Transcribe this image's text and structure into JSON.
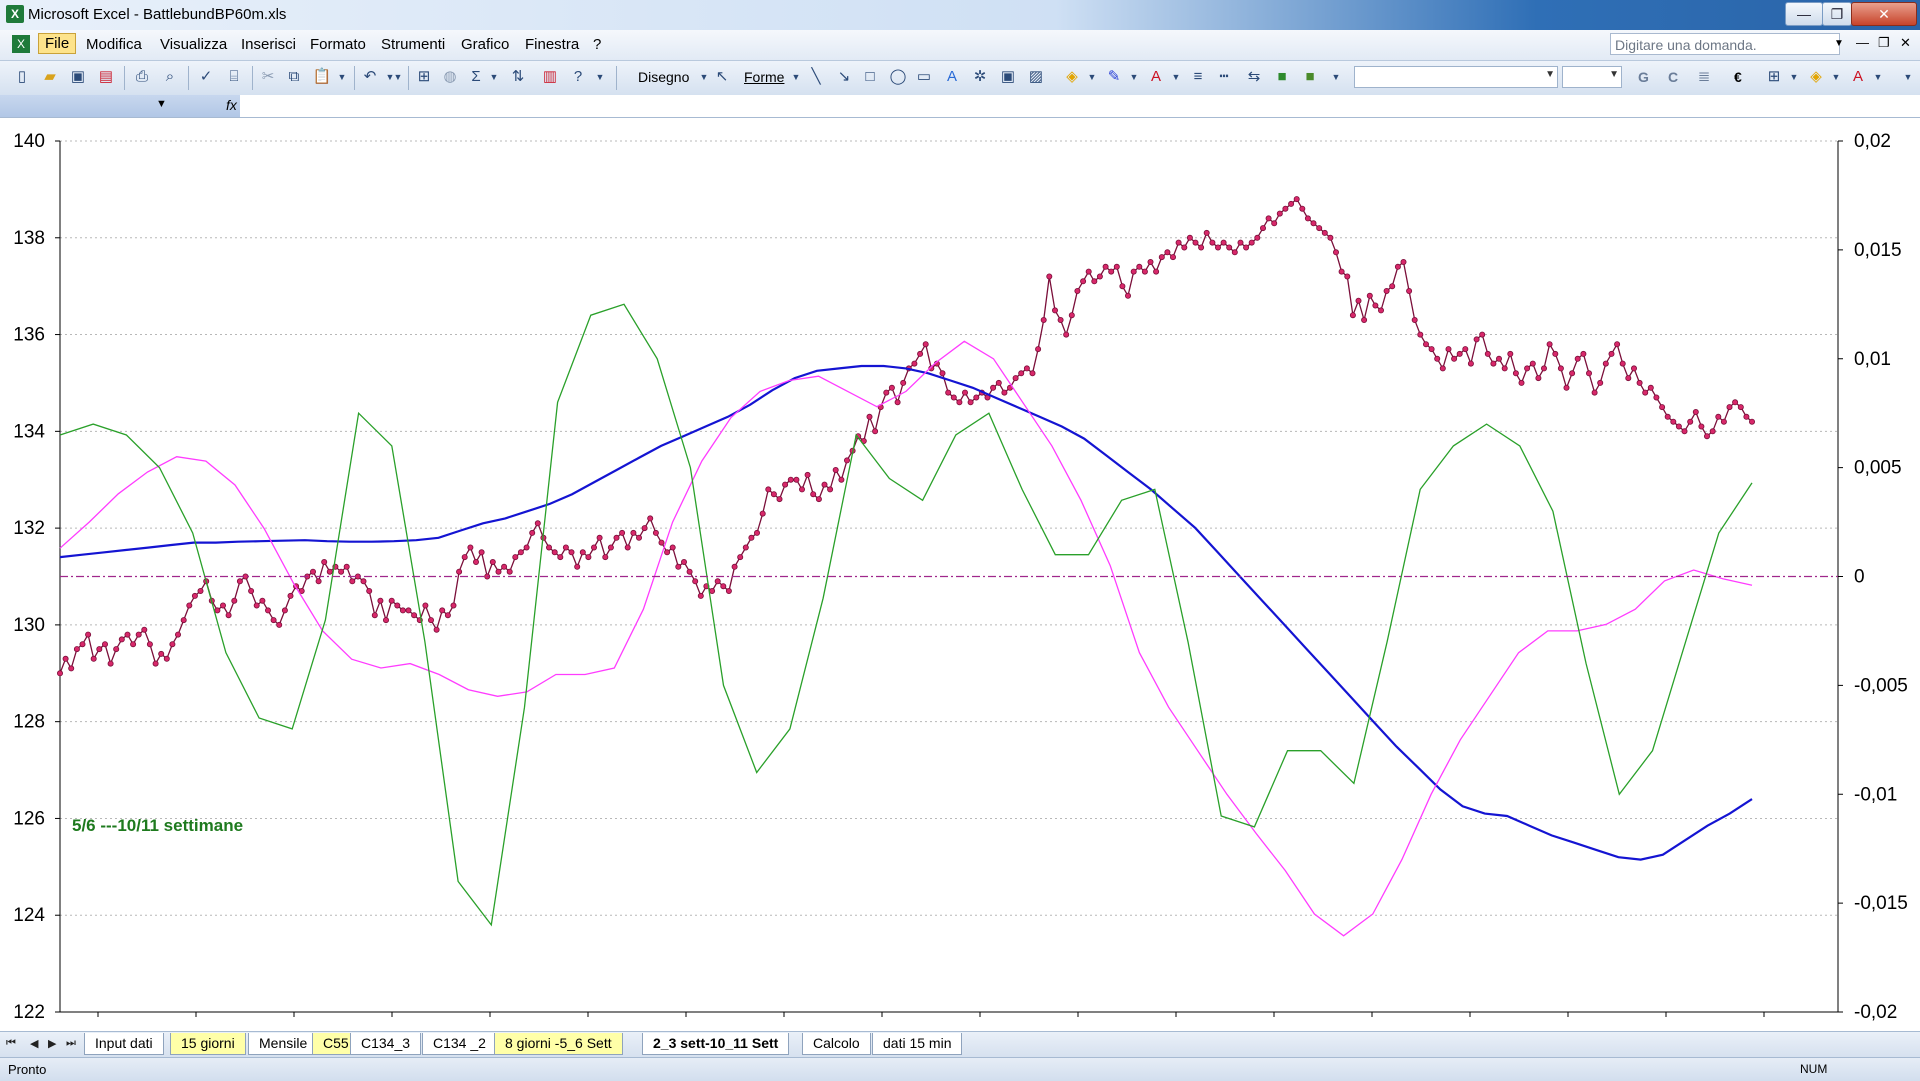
{
  "window": {
    "app_title": "Microsoft Excel - BattlebundBP60m.xls",
    "controls": [
      "—",
      "❐",
      "✕"
    ]
  },
  "menu": {
    "items": [
      "File",
      "Modifica",
      "Visualizza",
      "Inserisci",
      "Formato",
      "Strumenti",
      "Grafico",
      "Finestra",
      "?"
    ],
    "help_placeholder": "Digitare una domanda.",
    "doc_controls": [
      "—",
      "❐",
      "✕"
    ]
  },
  "toolbar": {
    "drawing_label": "Disegno",
    "shapes_label": "Forme",
    "bold_label": "G",
    "italic_label": "C",
    "euro_label": "€"
  },
  "formula_bar": {
    "fx_label": "fx"
  },
  "chart": {
    "annotation": "5/6 ---10/11 settimane",
    "annotation_color": "#1e7a1e",
    "y_left_ticks": [
      "140",
      "138",
      "136",
      "134",
      "132",
      "130",
      "128",
      "126",
      "124",
      "122"
    ],
    "y_right_ticks": [
      "0,02",
      "0,015",
      "0,01",
      "0,005",
      "0",
      "-0,005",
      "-0,01",
      "-0,015",
      "-0,02"
    ]
  },
  "chart_data": {
    "type": "line",
    "title": "",
    "xlabel": "",
    "ylabel": "",
    "ylim_left": [
      122,
      140
    ],
    "ylim_right": [
      -0.02,
      0.02
    ],
    "grid": "horizontal dotted",
    "x_points": 226,
    "series": [
      {
        "axis": "left",
        "color": "#7b0f3a",
        "marker_color": "#d8286a",
        "markers": true,
        "values": [
          129.0,
          129.3,
          129.1,
          129.5,
          129.6,
          129.8,
          129.3,
          129.5,
          129.6,
          129.2,
          129.5,
          129.7,
          129.8,
          129.6,
          129.8,
          129.9,
          129.6,
          129.2,
          129.4,
          129.3,
          129.6,
          129.8,
          130.1,
          130.4,
          130.6,
          130.7,
          130.9,
          130.5,
          130.3,
          130.4,
          130.2,
          130.5,
          130.9,
          131.0,
          130.7,
          130.4,
          130.5,
          130.3,
          130.1,
          130.0,
          130.3,
          130.6,
          130.8,
          130.7,
          131.0,
          131.1,
          130.9,
          131.3,
          131.1,
          131.2,
          131.1,
          131.2,
          130.9,
          131.0,
          130.9,
          130.7,
          130.2,
          130.5,
          130.1,
          130.5,
          130.4,
          130.3,
          130.3,
          130.2,
          130.1,
          130.4,
          130.1,
          129.9,
          130.3,
          130.2,
          130.4,
          131.1,
          131.4,
          131.6,
          131.3,
          131.5,
          131.0,
          131.3,
          131.1,
          131.2,
          131.1,
          131.4,
          131.5,
          131.6,
          131.9,
          132.1,
          131.8,
          131.6,
          131.5,
          131.4,
          131.6,
          131.5,
          131.2,
          131.5,
          131.4,
          131.6,
          131.8,
          131.4,
          131.6,
          131.8,
          131.9,
          131.6,
          131.9,
          131.8,
          132.0,
          132.2,
          131.9,
          131.7,
          131.5,
          131.6,
          131.2,
          131.3,
          131.1,
          130.9,
          130.6,
          130.8,
          130.7,
          130.9,
          130.8,
          130.7,
          131.2,
          131.4,
          131.6,
          131.8,
          131.9,
          132.3,
          132.8,
          132.7,
          132.6,
          132.9,
          133.0,
          133.0,
          132.8,
          133.1,
          132.7,
          132.6,
          132.9,
          132.8,
          133.2,
          133.0,
          133.4,
          133.6,
          133.9,
          133.8,
          134.3,
          134.0,
          134.5,
          134.8,
          134.9,
          134.6,
          135.0,
          135.3,
          135.4,
          135.6,
          135.8,
          135.3,
          135.4,
          135.2,
          134.8,
          134.7,
          134.6,
          134.8,
          134.6,
          134.7,
          134.8,
          134.7,
          134.9,
          135.0,
          134.8,
          134.9,
          135.1,
          135.2,
          135.3,
          135.2,
          135.7,
          136.3,
          137.2,
          136.5,
          136.3,
          136.0,
          136.4,
          136.9,
          137.1,
          137.3,
          137.1,
          137.2,
          137.4,
          137.3,
          137.4,
          137.0,
          136.8,
          137.3,
          137.4,
          137.3,
          137.5,
          137.3,
          137.6,
          137.7,
          137.6,
          137.9,
          137.8,
          138.0,
          137.9,
          137.8,
          138.1,
          137.9,
          137.8,
          137.9,
          137.8,
          137.7,
          137.9,
          137.8,
          137.9,
          138.0,
          138.2,
          138.4,
          138.3,
          138.5,
          138.6,
          138.7,
          138.8,
          138.6,
          138.4,
          138.3,
          138.2,
          138.1,
          138.0,
          137.7,
          137.3,
          137.2,
          136.4,
          136.7,
          136.3,
          136.8,
          136.6,
          136.5,
          136.9,
          137.0,
          137.4,
          137.5,
          136.9,
          136.3,
          136.0,
          135.8,
          135.7,
          135.5,
          135.3,
          135.7,
          135.5,
          135.6,
          135.7,
          135.4,
          135.9,
          136.0,
          135.6,
          135.4,
          135.5,
          135.3,
          135.6,
          135.2,
          135.0,
          135.3,
          135.4,
          135.1,
          135.3,
          135.8,
          135.6,
          135.3,
          134.9,
          135.2,
          135.5,
          135.6,
          135.2,
          134.8,
          135.0,
          135.4,
          135.6,
          135.8,
          135.4,
          135.1,
          135.3,
          135.0,
          134.8,
          134.9,
          134.7,
          134.5,
          134.3,
          134.2,
          134.1,
          134.0,
          134.2,
          134.4,
          134.1,
          133.9,
          134.0,
          134.3,
          134.2,
          134.5,
          134.6,
          134.5,
          134.3,
          134.2
        ]
      },
      {
        "axis": "left",
        "color": "#1414d2",
        "markers": false,
        "values": [
          131.4,
          131.45,
          131.5,
          131.55,
          131.6,
          131.65,
          131.7,
          131.7,
          131.72,
          131.73,
          131.74,
          131.75,
          131.73,
          131.72,
          131.72,
          131.73,
          131.75,
          131.8,
          131.95,
          132.1,
          132.2,
          132.35,
          132.5,
          132.7,
          132.95,
          133.2,
          133.45,
          133.7,
          133.9,
          134.1,
          134.3,
          134.55,
          134.85,
          135.1,
          135.25,
          135.3,
          135.35,
          135.35,
          135.3,
          135.2,
          135.05,
          134.9,
          134.7,
          134.5,
          134.3,
          134.1,
          133.85,
          133.5,
          133.15,
          132.8,
          132.4,
          132.0,
          131.5,
          131.0,
          130.5,
          130.0,
          129.5,
          129.0,
          128.5,
          128.0,
          127.5,
          127.05,
          126.6,
          126.25,
          126.1,
          126.05,
          125.85,
          125.65,
          125.5,
          125.35,
          125.2,
          125.15,
          125.25,
          125.55,
          125.85,
          126.1,
          126.4
        ]
      },
      {
        "axis": "right",
        "color": "#ff3cff",
        "markers": false,
        "values": [
          0.0013,
          0.0025,
          0.0038,
          0.0048,
          0.0055,
          0.0053,
          0.0042,
          0.0022,
          -0.0003,
          -0.0025,
          -0.0038,
          -0.0042,
          -0.004,
          -0.0045,
          -0.0052,
          -0.0055,
          -0.0053,
          -0.0045,
          -0.0045,
          -0.0042,
          -0.0015,
          0.0025,
          0.0053,
          0.0073,
          0.0085,
          0.009,
          0.0092,
          0.0085,
          0.0078,
          0.0085,
          0.0098,
          0.0108,
          0.01,
          0.008,
          0.006,
          0.0035,
          0.0005,
          -0.0035,
          -0.006,
          -0.008,
          -0.01,
          -0.0118,
          -0.0135,
          -0.0155,
          -0.0165,
          -0.0155,
          -0.013,
          -0.01,
          -0.0075,
          -0.0055,
          -0.0035,
          -0.0025,
          -0.0025,
          -0.0022,
          -0.0015,
          -0.0002,
          0.0003,
          -0.0001,
          -0.0004
        ]
      },
      {
        "axis": "right",
        "color": "#2aa02a",
        "markers": false,
        "values": [
          0.0065,
          0.007,
          0.0065,
          0.005,
          0.002,
          -0.0035,
          -0.0065,
          -0.007,
          -0.002,
          0.0075,
          0.006,
          -0.003,
          -0.014,
          -0.016,
          -0.006,
          0.008,
          0.012,
          0.0125,
          0.01,
          0.005,
          -0.005,
          -0.009,
          -0.007,
          -0.001,
          0.0065,
          0.0045,
          0.0035,
          0.0065,
          0.0075,
          0.004,
          0.001,
          0.001,
          0.0035,
          0.004,
          -0.003,
          -0.011,
          -0.0115,
          -0.008,
          -0.008,
          -0.0095,
          -0.003,
          0.004,
          0.006,
          0.007,
          0.006,
          0.003,
          -0.004,
          -0.01,
          -0.008,
          -0.003,
          0.002,
          0.0043
        ]
      },
      {
        "axis": "right",
        "color": "#a0288c",
        "markers": false,
        "style": "dash-dot",
        "values": [
          0,
          0
        ]
      }
    ]
  },
  "sheet_tabs": {
    "nav": [
      "⏮",
      "◀",
      "▶",
      "⏭"
    ],
    "tabs": [
      {
        "label": "Input dati",
        "color": "white"
      },
      {
        "label": "15 giorni",
        "color": "yellow"
      },
      {
        "label": "Mensile",
        "color": "white"
      },
      {
        "label": "C55",
        "color": "yellow"
      },
      {
        "label": "C134_3",
        "color": "white"
      },
      {
        "label": "C134 _2",
        "color": "white"
      },
      {
        "label": "8 giorni -5_6 Sett",
        "color": "yellow"
      },
      {
        "label": "2_3 sett-10_11 Sett",
        "color": "active"
      },
      {
        "label": "Calcolo",
        "color": "white"
      },
      {
        "label": "dati 15 min",
        "color": "white"
      }
    ]
  },
  "status": {
    "text": "Pronto",
    "num_indicator": "NUM"
  }
}
